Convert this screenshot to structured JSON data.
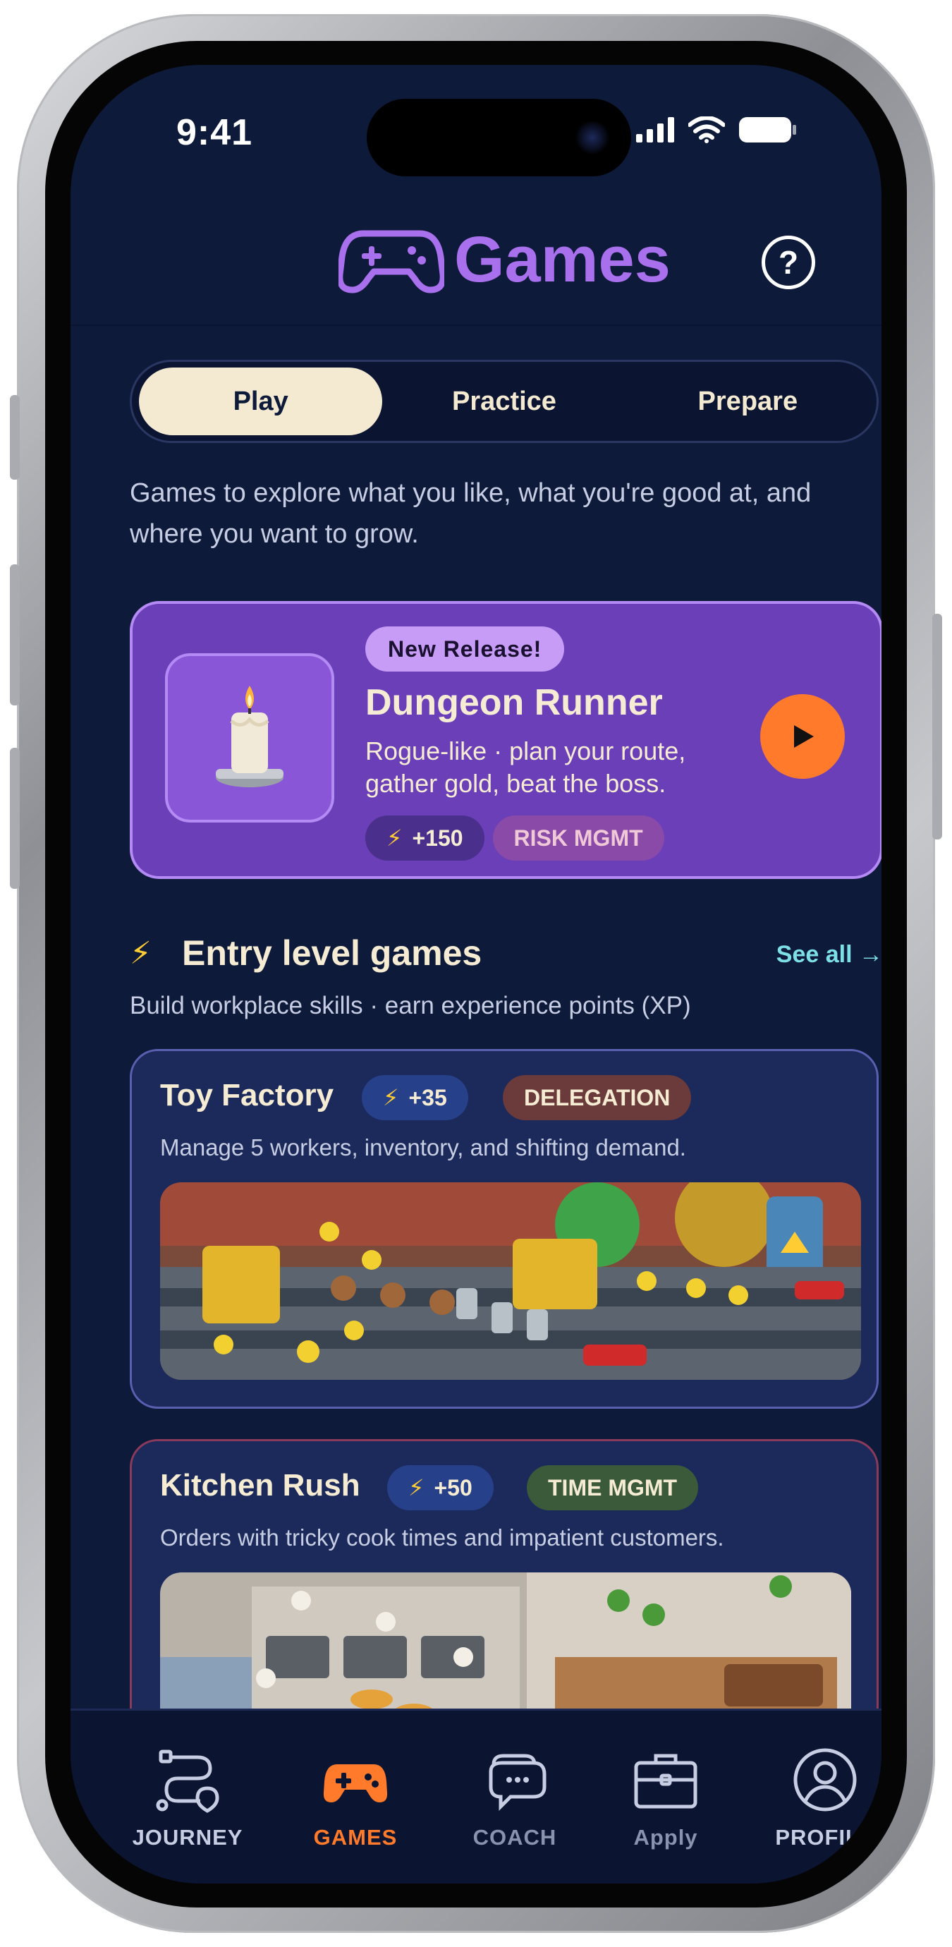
{
  "status_bar": {
    "time": "9:41"
  },
  "header": {
    "title": "Games",
    "help_icon": "question-circle-icon"
  },
  "tabs": [
    {
      "label": "Play",
      "active": true
    },
    {
      "label": "Practice",
      "active": false
    },
    {
      "label": "Prepare",
      "active": false
    }
  ],
  "intro": "Games to explore what you like, what you're good at, and where you want to grow.",
  "featured": {
    "badge": "New Release!",
    "name": "Dungeon Runner",
    "description": "Rogue-like · plan your route, gather gold, beat the boss.",
    "xp": "+150",
    "skill": "RISK MGMT",
    "thumb_icon": "candle-icon"
  },
  "entry_section": {
    "icon": "lightning-icon",
    "title": "Entry level games",
    "see_all": "See all →",
    "subtitle": "Build workplace skills · earn experience points (XP)"
  },
  "games": [
    {
      "name": "Toy Factory",
      "xp": "+35",
      "skill": "DELEGATION",
      "description": "Manage 5 workers, inventory, and shifting demand."
    },
    {
      "name": "Kitchen Rush",
      "xp": "+50",
      "skill": "TIME MGMT",
      "description": "Orders with tricky cook times and impatient customers."
    }
  ],
  "bottom_nav": [
    {
      "label": "JOURNEY",
      "icon": "route-icon",
      "active": false
    },
    {
      "label": "GAMES",
      "icon": "gamepad-icon",
      "active": true
    },
    {
      "label": "COACH",
      "icon": "chat-bubbles-icon",
      "active": false
    },
    {
      "label": "Apply",
      "icon": "briefcase-icon",
      "active": false
    },
    {
      "label": "PROFILE",
      "icon": "user-circle-icon",
      "active": false
    }
  ],
  "colors": {
    "background": "#0e1a3a",
    "accent_purple": "#a970ee",
    "accent_orange": "#ff7a2a",
    "cream": "#f4ead2",
    "link_teal": "#7de0e6"
  }
}
